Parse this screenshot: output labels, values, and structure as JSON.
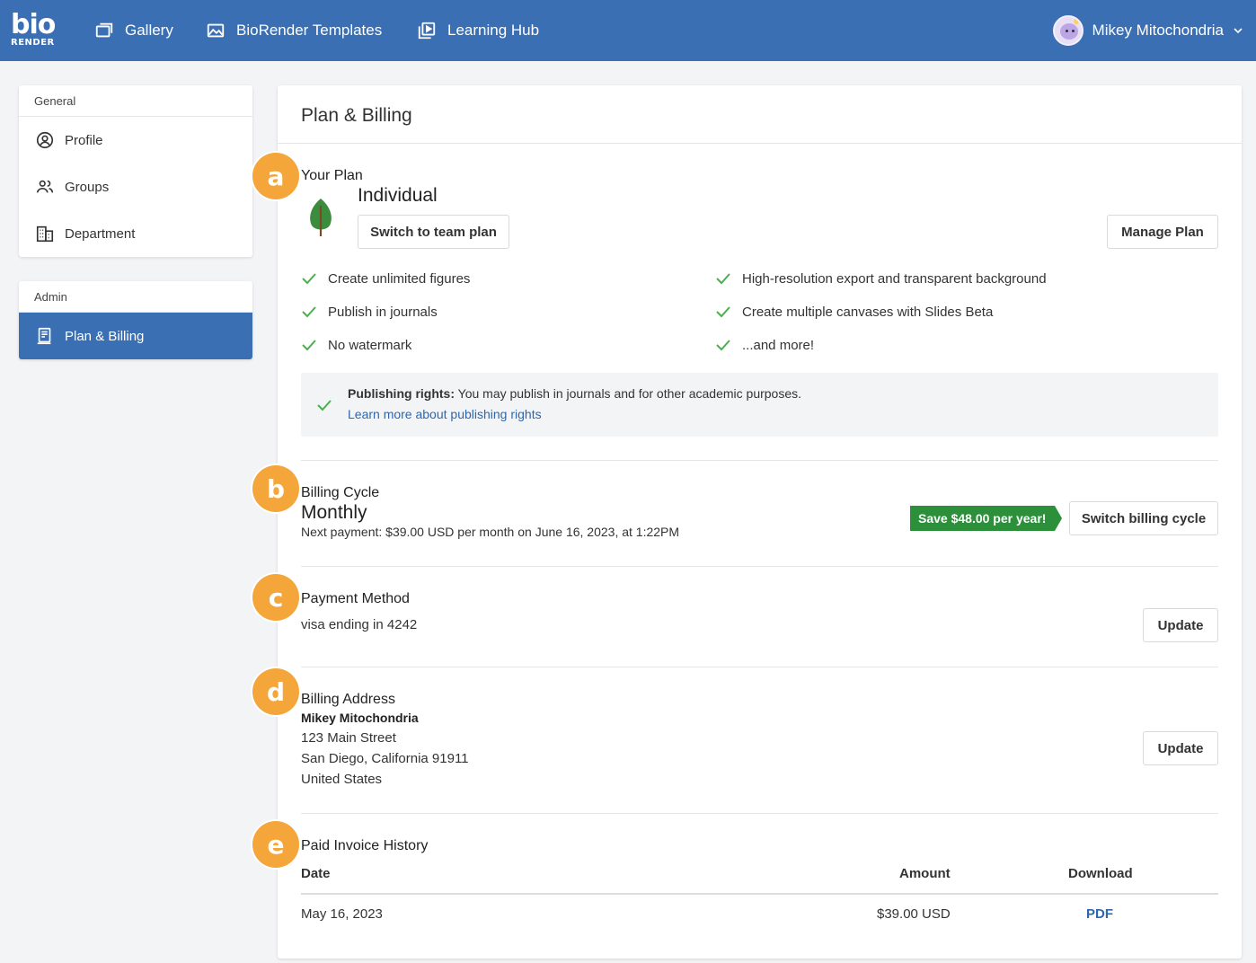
{
  "topbar": {
    "logo_top": "bio",
    "logo_bottom": "RENDER",
    "nav": [
      {
        "label": "Gallery",
        "icon": "gallery-icon"
      },
      {
        "label": "BioRender Templates",
        "icon": "image-icon"
      },
      {
        "label": "Learning Hub",
        "icon": "play-icon"
      }
    ],
    "user_name": "Mikey Mitochondria"
  },
  "sidebar": {
    "general_heading": "General",
    "general_items": [
      {
        "label": "Profile",
        "icon": "profile-icon"
      },
      {
        "label": "Groups",
        "icon": "groups-icon"
      },
      {
        "label": "Department",
        "icon": "building-icon"
      }
    ],
    "admin_heading": "Admin",
    "admin_items": [
      {
        "label": "Plan & Billing",
        "icon": "billing-icon",
        "active": true
      }
    ]
  },
  "main": {
    "title": "Plan & Billing",
    "plan": {
      "label": "Your Plan",
      "name": "Individual",
      "switch_button": "Switch to team plan",
      "manage_button": "Manage Plan",
      "features_left": [
        "Create unlimited figures",
        "Publish in journals",
        "No watermark"
      ],
      "features_right": [
        "High-resolution export and transparent background",
        "Create multiple canvases with Slides Beta",
        "...and more!"
      ],
      "rights_bold": "Publishing rights:",
      "rights_text": " You may publish in journals and for other academic purposes.",
      "rights_link": "Learn more about publishing rights"
    },
    "billing_cycle": {
      "label": "Billing Cycle",
      "value": "Monthly",
      "next_payment": "Next payment: $39.00 USD per month on June 16, 2023, at 1:22PM",
      "save_badge": "Save $48.00 per year!",
      "switch_button": "Switch billing cycle"
    },
    "payment_method": {
      "label": "Payment Method",
      "value": "visa ending in 4242",
      "update_button": "Update"
    },
    "billing_address": {
      "label": "Billing Address",
      "name": "Mikey Mitochondria",
      "line1": "123 Main Street",
      "line2": "San Diego, California 91911",
      "country": "United States",
      "update_button": "Update"
    },
    "invoices": {
      "label": "Paid Invoice History",
      "headers": {
        "date": "Date",
        "amount": "Amount",
        "download": "Download"
      },
      "rows": [
        {
          "date": "May 16, 2023",
          "amount": "$39.00 USD",
          "download": "PDF"
        }
      ]
    }
  },
  "annotations": [
    "a",
    "b",
    "c",
    "d",
    "e"
  ],
  "colors": {
    "brand_blue": "#3b6fb3",
    "check_green": "#4caf50",
    "badge_green": "#2c8f3a",
    "annotation_orange": "#f4a63a",
    "link_blue": "#2d67ad"
  }
}
